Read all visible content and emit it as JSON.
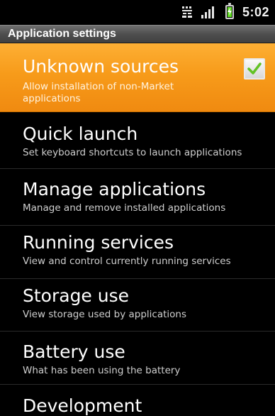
{
  "status_bar": {
    "time": "5:02",
    "icons": [
      "data-network-icon",
      "signal-strength-icon",
      "battery-charging-icon"
    ]
  },
  "header": {
    "title": "Application settings"
  },
  "settings": [
    {
      "title": "Unknown sources",
      "summary": "Allow installation of non-Market applications",
      "checked": true,
      "selected": true
    },
    {
      "title": "Quick launch",
      "summary": "Set keyboard shortcuts to launch applications"
    },
    {
      "title": "Manage applications",
      "summary": "Manage and remove installed applications"
    },
    {
      "title": "Running services",
      "summary": "View and control currently running services"
    },
    {
      "title": "Storage use",
      "summary": "View storage used by applications"
    },
    {
      "title": "Battery use",
      "summary": "What has been using the battery"
    },
    {
      "title": "Development",
      "summary": ""
    }
  ],
  "colors": {
    "selected_background": "#f79b1a",
    "checkmark": "#62c224",
    "background": "#000000"
  }
}
